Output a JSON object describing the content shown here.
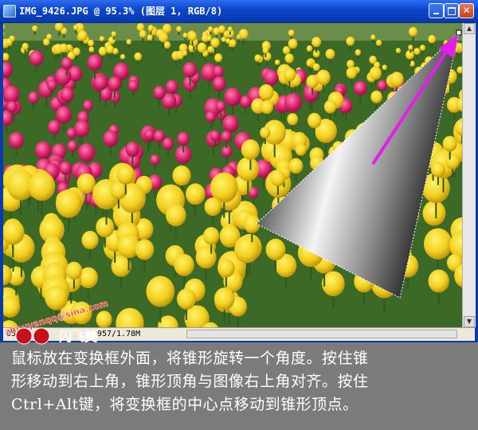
{
  "window": {
    "title": "IMG_9426.JPG @ 95.3% (图层 1, RGB/8)"
  },
  "statusbar": {
    "zoom": "95.3",
    "doc_info": "957/1.78M"
  },
  "watermark": {
    "text": "zhouyanqq@sina.com",
    "logo": "闪飞美"
  },
  "caption": {
    "lines": [
      "鼠标放在变换框外面，将锥形旋转一个角度。按住锥",
      "形移动到右上角，锥形顶角与图像右上角对齐。按住",
      "Ctrl+Alt键，将变换框的中心点移动到锥形顶点。"
    ]
  },
  "colors": {
    "titlebar": "#0a45c8",
    "arrow": "#e31ee6",
    "caption_text": "#ffffff",
    "background": "#7b7b7b"
  }
}
